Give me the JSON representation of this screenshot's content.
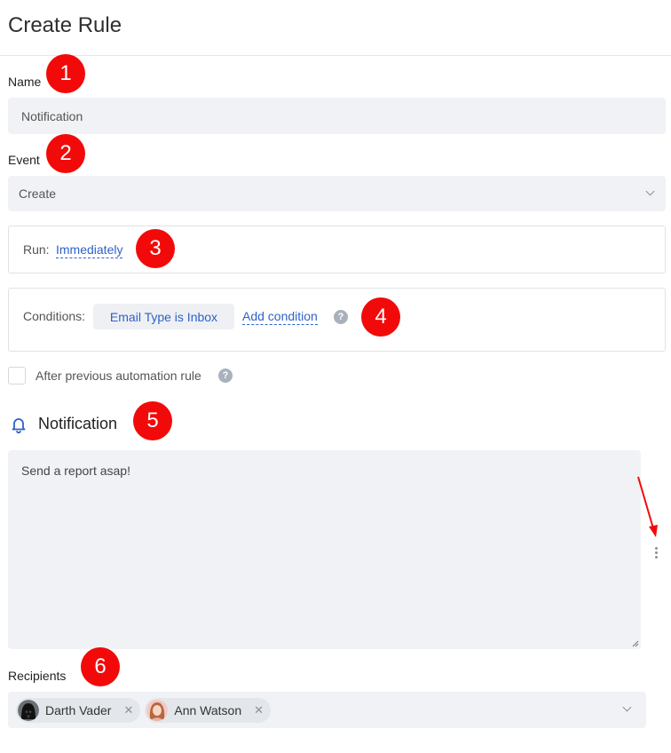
{
  "page": {
    "title": "Create Rule"
  },
  "name_field": {
    "label": "Name",
    "value": "Notification"
  },
  "event_field": {
    "label": "Event",
    "value": "Create"
  },
  "run": {
    "label": "Run:",
    "value": "Immediately"
  },
  "conditions": {
    "label": "Conditions:",
    "items": [
      "Email Type is Inbox"
    ],
    "add_label": "Add condition",
    "help_icon": "question-icon"
  },
  "after_previous": {
    "label": "After previous automation rule",
    "checked": false,
    "help_icon": "question-icon"
  },
  "notification": {
    "icon": "bell-icon",
    "title": "Notification",
    "message": "Send a report asap!"
  },
  "recipients": {
    "label": "Recipients",
    "items": [
      {
        "name": "Darth Vader",
        "avatar": "darth-vader-avatar"
      },
      {
        "name": "Ann Watson",
        "avatar": "ann-watson-avatar"
      }
    ]
  },
  "annotations": [
    "1",
    "2",
    "3",
    "4",
    "5",
    "6"
  ],
  "colors": {
    "accent": "#2e62c9",
    "badge": "#f20a0a",
    "field_bg": "#f1f2f5"
  }
}
